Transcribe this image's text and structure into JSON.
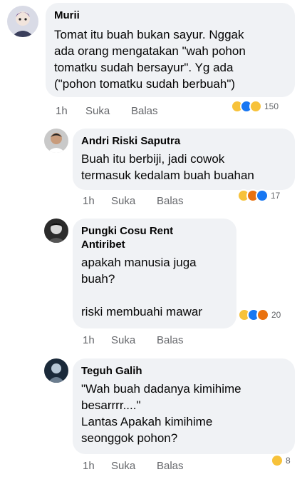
{
  "comments": [
    {
      "author": "Murii",
      "text": "Tomat itu buah bukan sayur. Nggak\nada orang mengatakan \"wah pohon\ntomatku sudah bersayur\". Yg ada\n(\"pohon tomatku sudah berbuah\")",
      "time": "1h",
      "like_label": "Suka",
      "reply_label": "Balas",
      "reaction_count": "150",
      "reactions": [
        "haha",
        "like",
        "care"
      ]
    },
    {
      "author": "Andri Riski Saputra",
      "text": "Buah itu berbiji, jadi cowok\ntermasuk kedalam buah buahan",
      "time": "1h",
      "like_label": "Suka",
      "reply_label": "Balas",
      "reaction_count": "17",
      "reactions": [
        "haha",
        "angry",
        "like"
      ]
    },
    {
      "author": "Pungki Cosu Rent\nAntiribet",
      "text": "apakah manusia juga\nbuah?\n\nriski membuahi mawar",
      "time": "1h",
      "like_label": "Suka",
      "reply_label": "Balas",
      "reaction_count": "20",
      "reactions": [
        "haha",
        "like",
        "angry"
      ]
    },
    {
      "author": "Teguh Galih",
      "text": "\"Wah buah dadanya kimihime\nbesarrrr....\"\nLantas Apakah kimihime\nseonggok pohon?",
      "time": "1h",
      "like_label": "Suka",
      "reply_label": "Balas",
      "reaction_count": "8",
      "reactions": [
        "haha"
      ]
    }
  ]
}
